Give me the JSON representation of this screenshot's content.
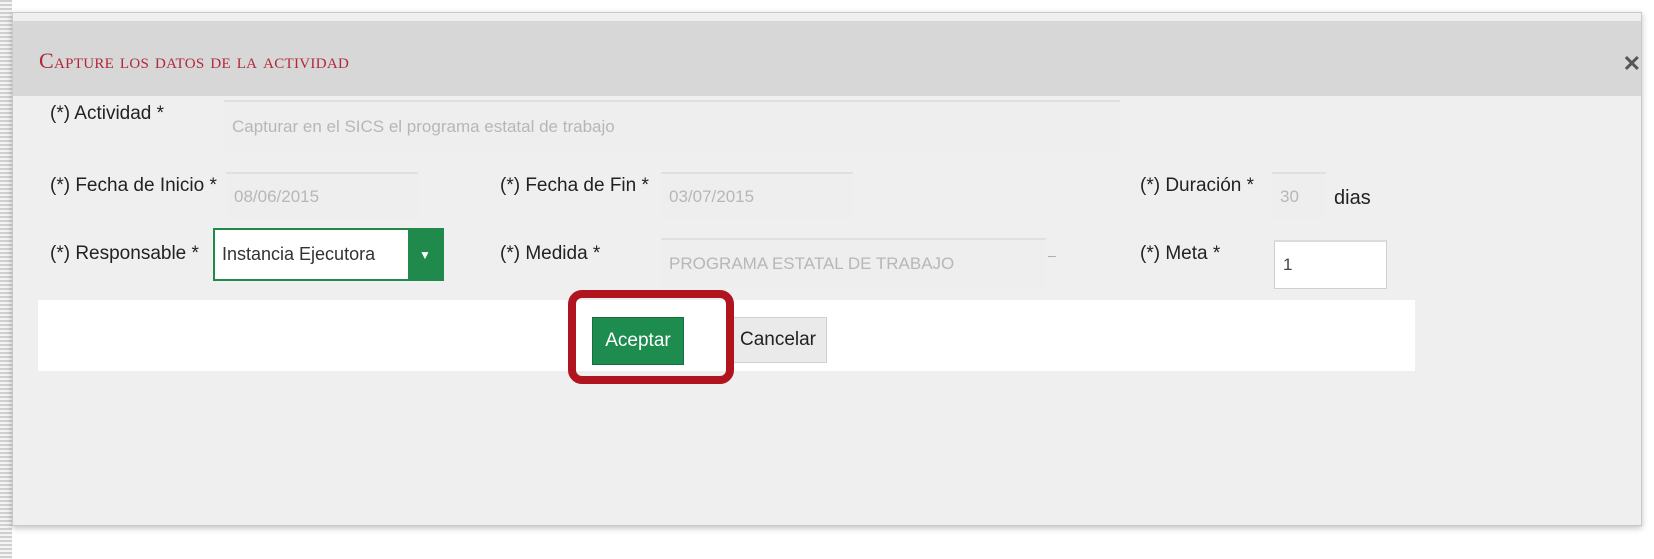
{
  "dialog": {
    "title": "Capture los datos de la actividad",
    "close_icon": "close-icon"
  },
  "form": {
    "actividad_label": "(*) Actividad *",
    "actividad_value": "Capturar en el SICS el programa estatal de trabajo",
    "fecha_inicio_label": "(*) Fecha de Inicio *",
    "fecha_inicio_value": "08/06/2015",
    "fecha_fin_label": "(*) Fecha de Fin *",
    "fecha_fin_value": "03/07/2015",
    "duracion_label": "(*) Duración *",
    "duracion_value": "30",
    "duracion_unit": "dias",
    "responsable_label": "(*) Responsable *",
    "responsable_value": "Instancia Ejecutora",
    "medida_label": "(*) Medida *",
    "medida_value": "PROGRAMA ESTATAL DE TRABAJO",
    "meta_label": "(*) Meta *",
    "meta_value": "1"
  },
  "buttons": {
    "accept": "Aceptar",
    "cancel": "Cancelar"
  },
  "colors": {
    "title": "#b0283b",
    "accent_green": "#1e8c4e",
    "highlight_red": "#b0141e"
  }
}
